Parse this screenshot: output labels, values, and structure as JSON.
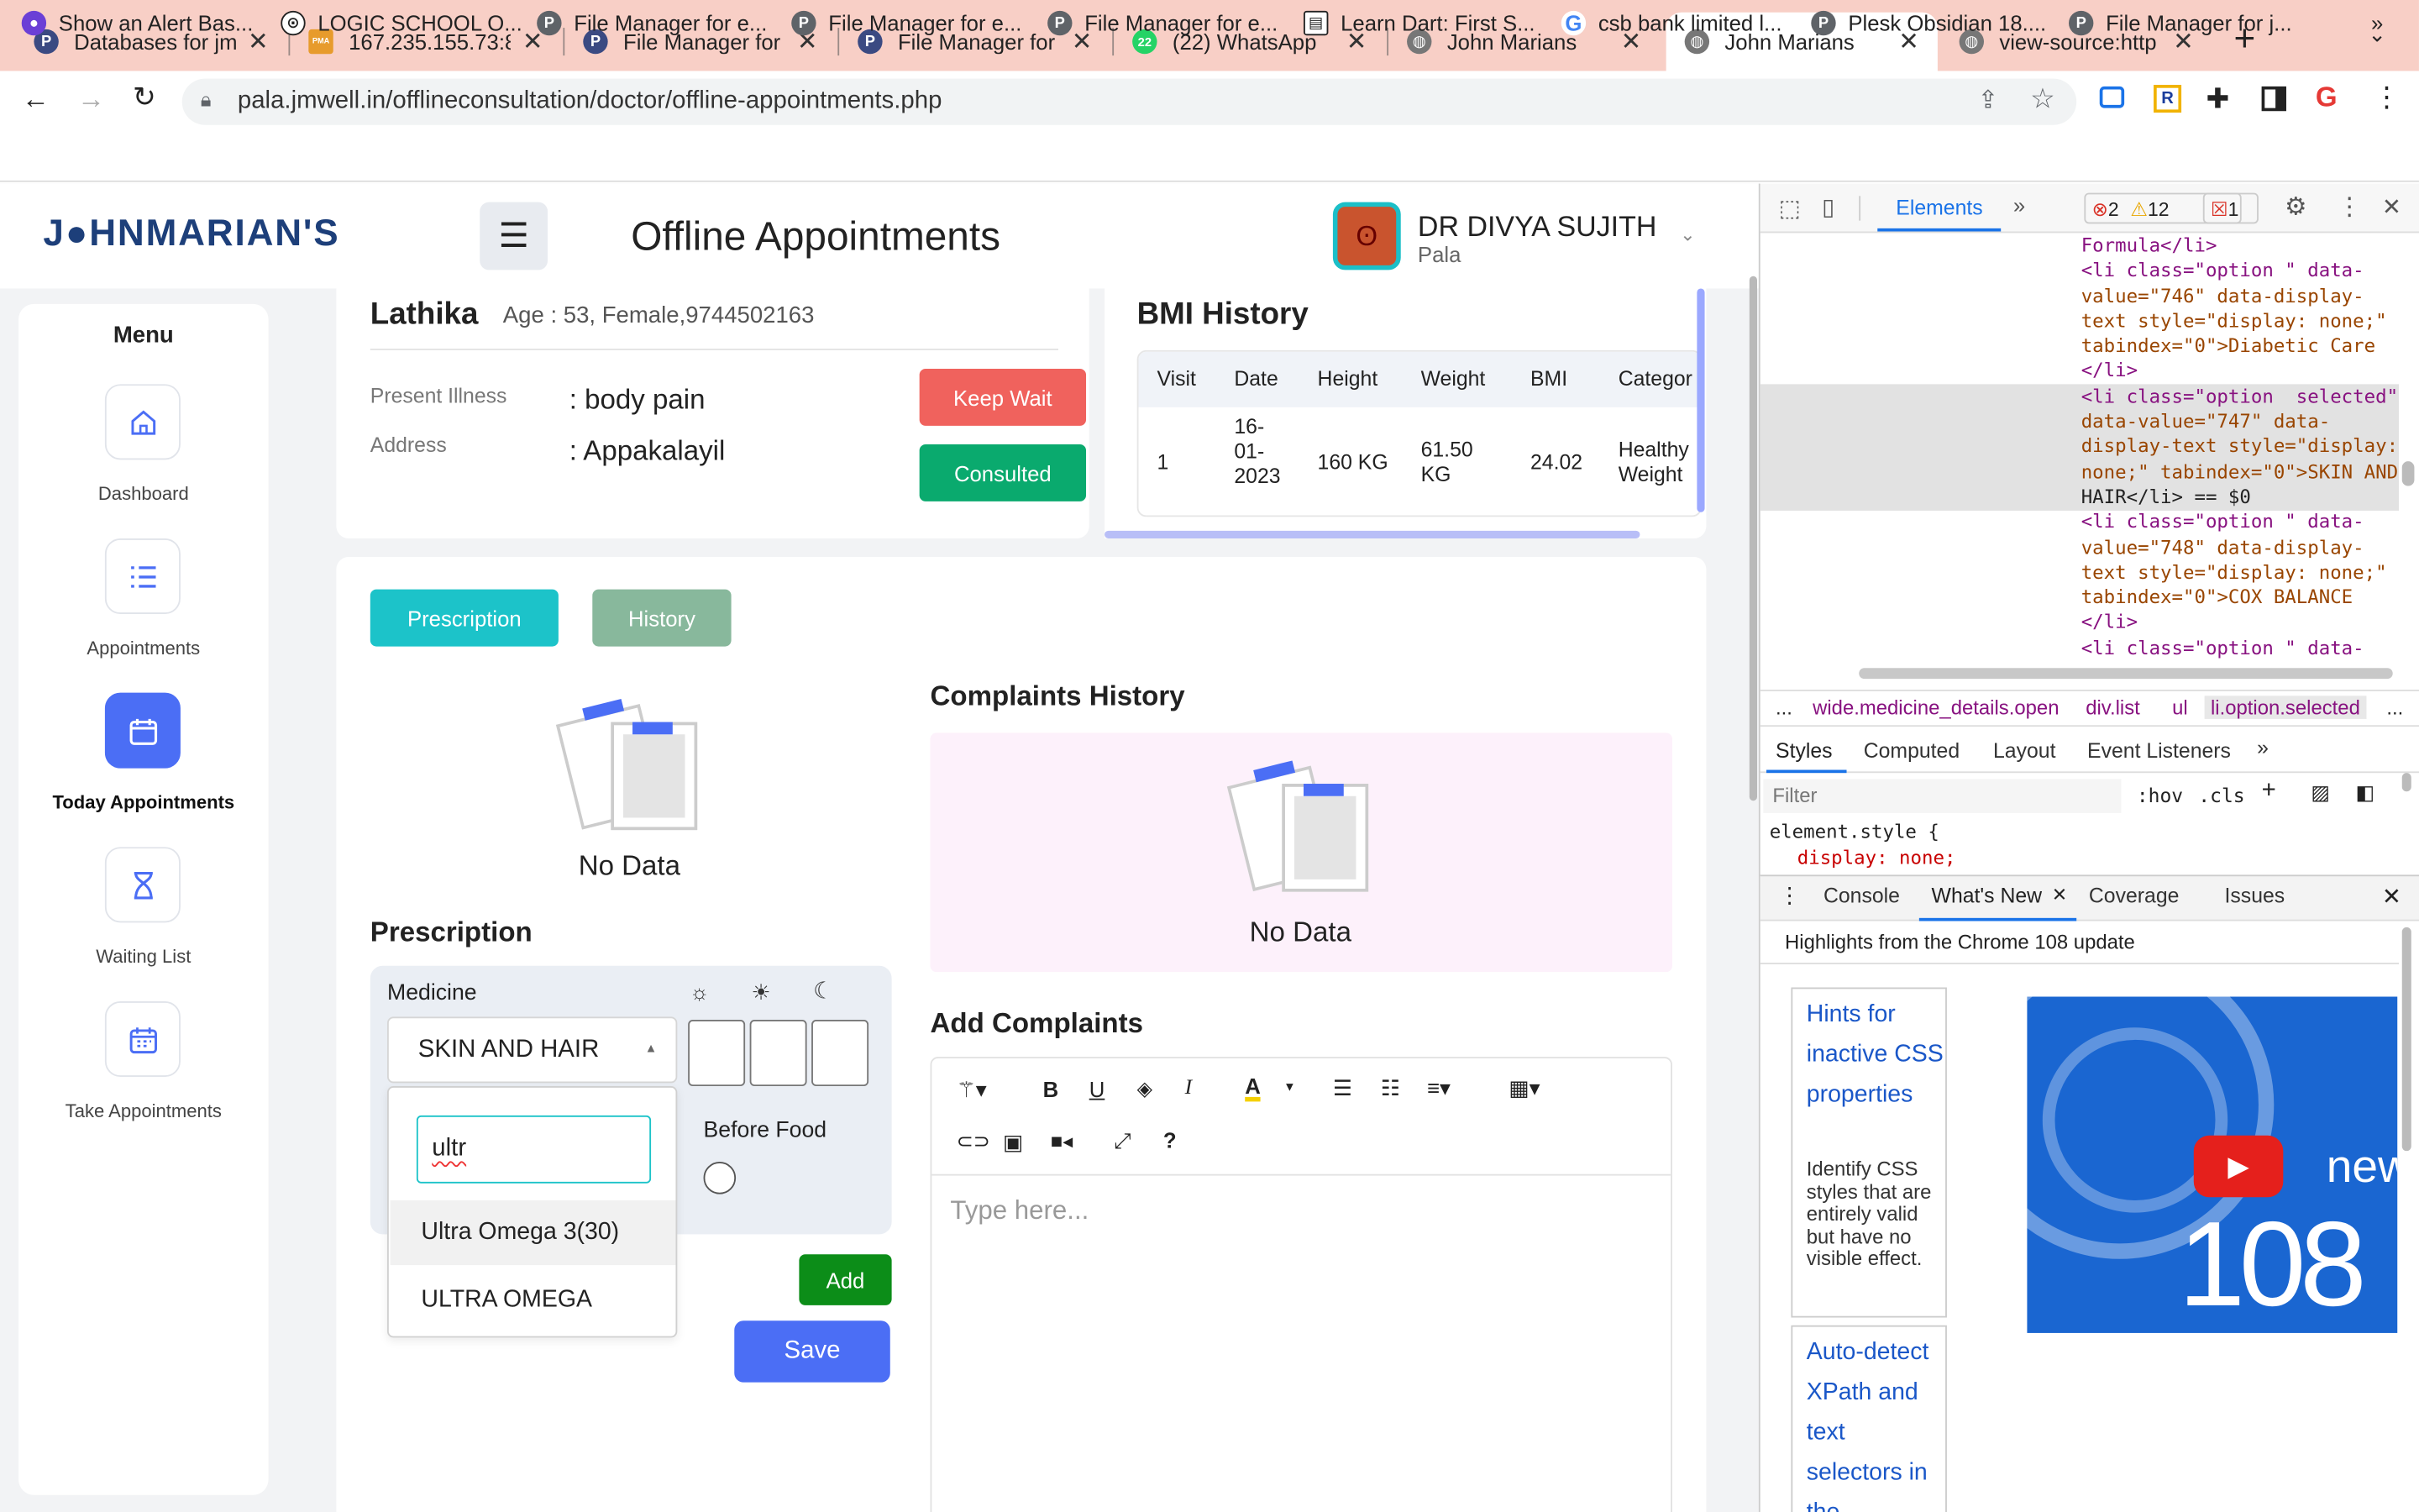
{
  "browser": {
    "tabs": [
      {
        "favicon": "P",
        "title": "Databases for jmw"
      },
      {
        "favicon": "PMA",
        "title": "167.235.155.73:8"
      },
      {
        "favicon": "P",
        "title": "File Manager for p"
      },
      {
        "favicon": "P",
        "title": "File Manager for p"
      },
      {
        "favicon": "22",
        "title": "(22) WhatsApp"
      },
      {
        "favicon": "globe-icon",
        "title": "John Marians"
      },
      {
        "favicon": "globe-icon",
        "title": "John Marians"
      },
      {
        "favicon": "globe-icon",
        "title": "view-source:http"
      }
    ],
    "url": "pala.jmwell.in/offlineconsultation/doctor/offline-appointments.php",
    "bookmarks": [
      "Show an Alert Bas...",
      "LOGIC SCHOOL O...",
      "File Manager for e...",
      "File Manager for e...",
      "File Manager for e...",
      "Learn Dart: First S...",
      "csb bank limited l...",
      "Plesk Obsidian 18....",
      "File Manager for j..."
    ]
  },
  "header": {
    "logo": "J●HNMARIAN'S",
    "title": "Offline Appointments",
    "doctor_name": "DR DIVYA SUJITH",
    "doctor_location": "Pala"
  },
  "sidebar": {
    "title": "Menu",
    "items": [
      {
        "icon": "home-icon",
        "label": "Dashboard"
      },
      {
        "icon": "list-icon",
        "label": "Appointments"
      },
      {
        "icon": "calendar-icon",
        "label": "Today Appointments",
        "active": true
      },
      {
        "icon": "hourglass-icon",
        "label": "Waiting List"
      },
      {
        "icon": "calendar-grid-icon",
        "label": "Take Appointments"
      }
    ]
  },
  "patient": {
    "name": "Lathika",
    "details": "Age : 53, Female,9744502163",
    "illness_label": "Present Illness",
    "illness_value": ": body pain",
    "address_label": "Address",
    "address_value": ": Appakalayil",
    "keep_wait": "Keep Wait",
    "consulted": "Consulted"
  },
  "bmi": {
    "title": "BMI History",
    "headers": [
      "Visit",
      "Date",
      "Height",
      "Weight",
      "BMI",
      "Categor"
    ],
    "rows": [
      [
        "1",
        "16-\n01-\n2023",
        "160 KG",
        "61.50\nKG",
        "24.02",
        "Healthy\nWeight"
      ]
    ]
  },
  "tabs": {
    "prescription": "Prescription",
    "history": "History"
  },
  "nodata": "No Data",
  "complaints_history": {
    "title": "Complaints History",
    "nodata": "No Data"
  },
  "prescription": {
    "title": "Prescription",
    "medicine_label": "Medicine",
    "selected": "SKIN AND HAIR",
    "search_value": "ultr",
    "options": [
      "Ultra Omega 3(30)",
      "ULTRA OMEGA"
    ],
    "before_food": "Before Food",
    "add": "Add",
    "save": "Save"
  },
  "complaints": {
    "title": "Add Complaints",
    "placeholder": "Type here..."
  },
  "devtools": {
    "tabs": {
      "elements": "Elements",
      "errors": "2",
      "warnings": "12",
      "issues": "1"
    },
    "code": [
      {
        "t": "Formula</li>",
        "hl": false
      },
      {
        "t": "<li class=\"option \" data-",
        "hl": false
      },
      {
        "t": "value=\"746\" data-display-",
        "hl": false
      },
      {
        "t": "text style=\"display: none;\"",
        "hl": false
      },
      {
        "t": "tabindex=\"0\">Diabetic Care",
        "hl": false
      },
      {
        "t": "</li>",
        "hl": false
      },
      {
        "t": "<li class=\"option  selected\"",
        "hl": true
      },
      {
        "t": "data-value=\"747\" data-",
        "hl": true
      },
      {
        "t": "display-text style=\"display:",
        "hl": true
      },
      {
        "t": "none;\" tabindex=\"0\">SKIN AND",
        "hl": true
      },
      {
        "t": "HAIR</li> == $0",
        "hl": true
      },
      {
        "t": "<li class=\"option \" data-",
        "hl": false
      },
      {
        "t": "value=\"748\" data-display-",
        "hl": false
      },
      {
        "t": "text style=\"display: none;\"",
        "hl": false
      },
      {
        "t": "tabindex=\"0\">COX BALANCE",
        "hl": false
      },
      {
        "t": "</li>",
        "hl": false
      },
      {
        "t": "<li class=\"option \" data-",
        "hl": false
      }
    ],
    "breadcrumb": [
      "...",
      "wide.medicine_details.open",
      "div.list",
      "ul",
      "li.option.selected",
      "..."
    ],
    "style_tabs": [
      "Styles",
      "Computed",
      "Layout",
      "Event Listeners"
    ],
    "filter_placeholder": "Filter",
    "hov": ":hov",
    "cls": ".cls",
    "style_rule": "element.style {",
    "style_decl": "display: none;",
    "drawer_tabs": [
      "Console",
      "What's New",
      "Coverage",
      "Issues"
    ],
    "highlights": "Highlights from the Chrome 108 update",
    "card1_title": "Hints for inactive CSS properties",
    "card1_desc": "Identify CSS styles that are entirely valid but have no visible effect.",
    "card2_title": "Auto-detect XPath and text selectors in the",
    "video_text": "new",
    "video_num": "108"
  }
}
